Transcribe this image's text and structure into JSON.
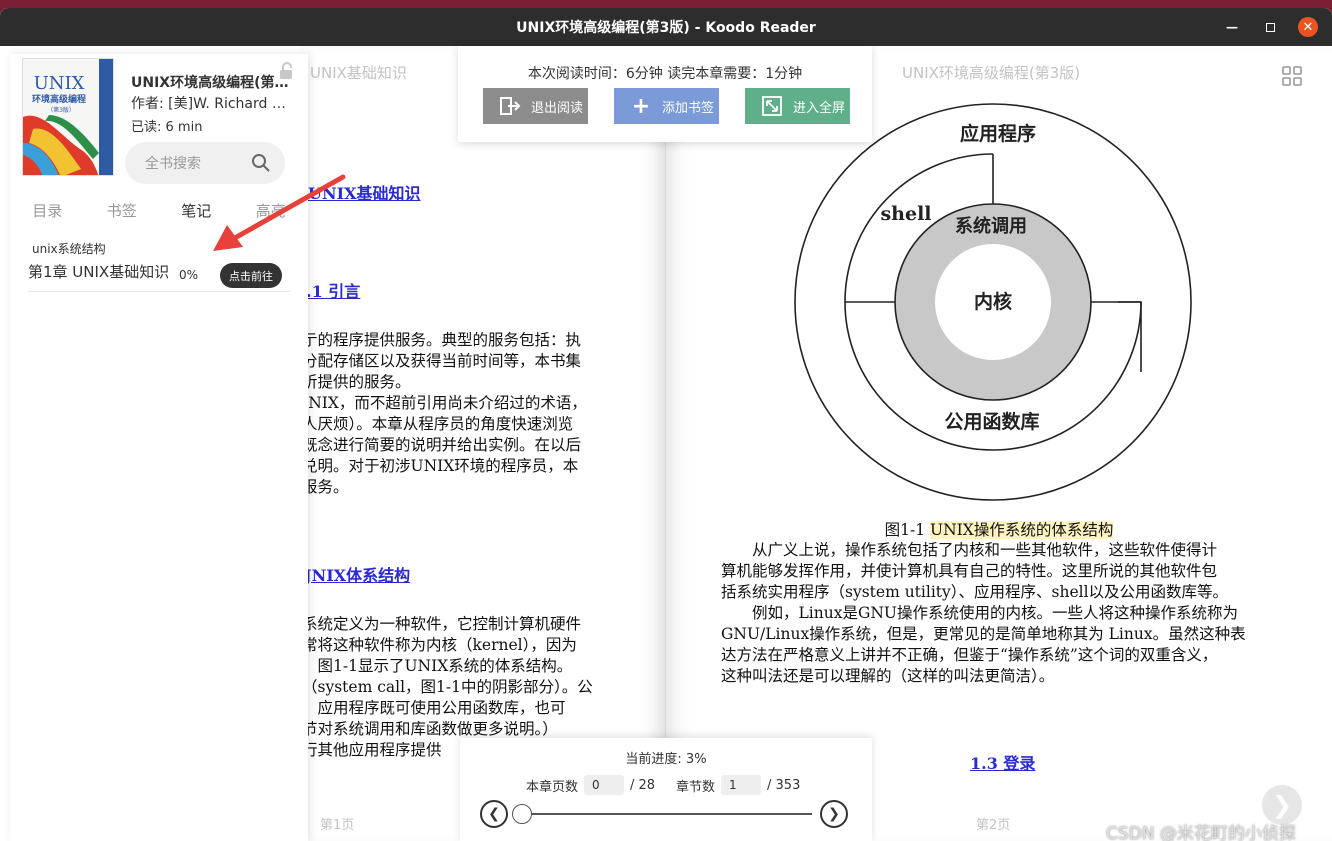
{
  "window": {
    "title": "UNIX环境高级编程(第3版) - Koodo Reader"
  },
  "book": {
    "title": "UNIX环境高级编程(第3版)",
    "author": "作者: [美]W. Richard Stevens",
    "read_time": "已读: 6  min",
    "cover_title": "UNIX",
    "cover_subtitle": "环境高级编程",
    "cover_edition": "（第3版）"
  },
  "sidebar": {
    "search_placeholder": "全书搜索",
    "tabs": [
      {
        "label": "目录"
      },
      {
        "label": "书签"
      },
      {
        "label": "笔记"
      },
      {
        "label": "高亮"
      }
    ],
    "active_tab": "笔记",
    "notes": [
      {
        "category": "unix系统结构",
        "chapter": "第1章 UNIX基础知识",
        "percent": "0%",
        "goto_label": "点击前往"
      }
    ]
  },
  "top_popup": {
    "read_time_text": "本次阅读时间：6分钟   读完本章需要：1分钟",
    "exit_label": "退出阅读",
    "bookmark_label": "添加书签",
    "fullscreen_label": "进入全屏",
    "colors": {
      "exit": "#8c8c8c",
      "bookmark": "#7a9bd8",
      "fullscreen": "#5fb08a"
    }
  },
  "bottom_popup": {
    "progress_text": "当前进度: 3%",
    "chapter_pages_label": "本章页数",
    "chapter_page_value": "0",
    "chapter_page_total": "/ 28",
    "section_label": "章节数",
    "section_value": "1",
    "section_total": "/ 353",
    "progress_fraction": 0.03
  },
  "left_page": {
    "running_head": "UNIX基础知识",
    "heading1": "UNIX基础知识",
    "heading2": ".1 引言",
    "para1": [
      "亍的程序提供服务。典型的服务包括：执",
      "分配存储区以及获得当前时间等，本书集",
      "听提供的服务。",
      "JNIX，而不超前引用尚未介绍过的术语，",
      "人厌烦）。本章从程序员的角度快速浏览",
      "既念进行简要的说明并给出实例。在以后",
      "兑明。对于初涉UNIX环境的程序员，本",
      "报务。"
    ],
    "heading3": "JNIX体系结构",
    "para2": [
      "系统定义为一种软件，它控制计算机硬件",
      "常将这种软件称为内核（kernel），因为",
      "。图1-1显示了UNIX系统的体系结构。",
      "（system call，图1-1中的阴影部分）。公",
      "，应用程序既可使用公用函数库，也可",
      "节对系统调用和库函数做更多说明。）",
      "行其他应用程序提供"
    ],
    "page_number": "第1页"
  },
  "right_page": {
    "running_head": "UNIX环境高级编程(第3版)",
    "diagram": {
      "app": "应用程序",
      "shell": "shell",
      "syscall": "系统调用",
      "kernel": "内核",
      "lib": "公用函数库"
    },
    "caption_prefix": "图1-1 ",
    "caption_highlight": "UNIX操作系统的体系结构",
    "body": [
      "　　从广义上说，操作系统包括了内核和一些其他软件，这些软件使得计",
      "算机能够发挥作用，并使计算机具有自己的特性。这里所说的其他软件包",
      "括系统实用程序（system utility）、应用程序、shell以及公用函数库等。",
      "　　例如，Linux是GNU操作系统使用的内核。一些人将这种操作系统称为",
      "GNU/Linux操作系统，但是，更常见的是简单地称其为 Linux。虽然这种表",
      "达方法在严格意义上讲并不正确，但鉴于“操作系统”这个词的双重含义，",
      "这种叫法还是可以理解的（这样的叫法更简洁）。"
    ],
    "heading": "1.3 登录",
    "page_number": "第2页"
  },
  "watermark": "CSDN @米花町的小侦探"
}
